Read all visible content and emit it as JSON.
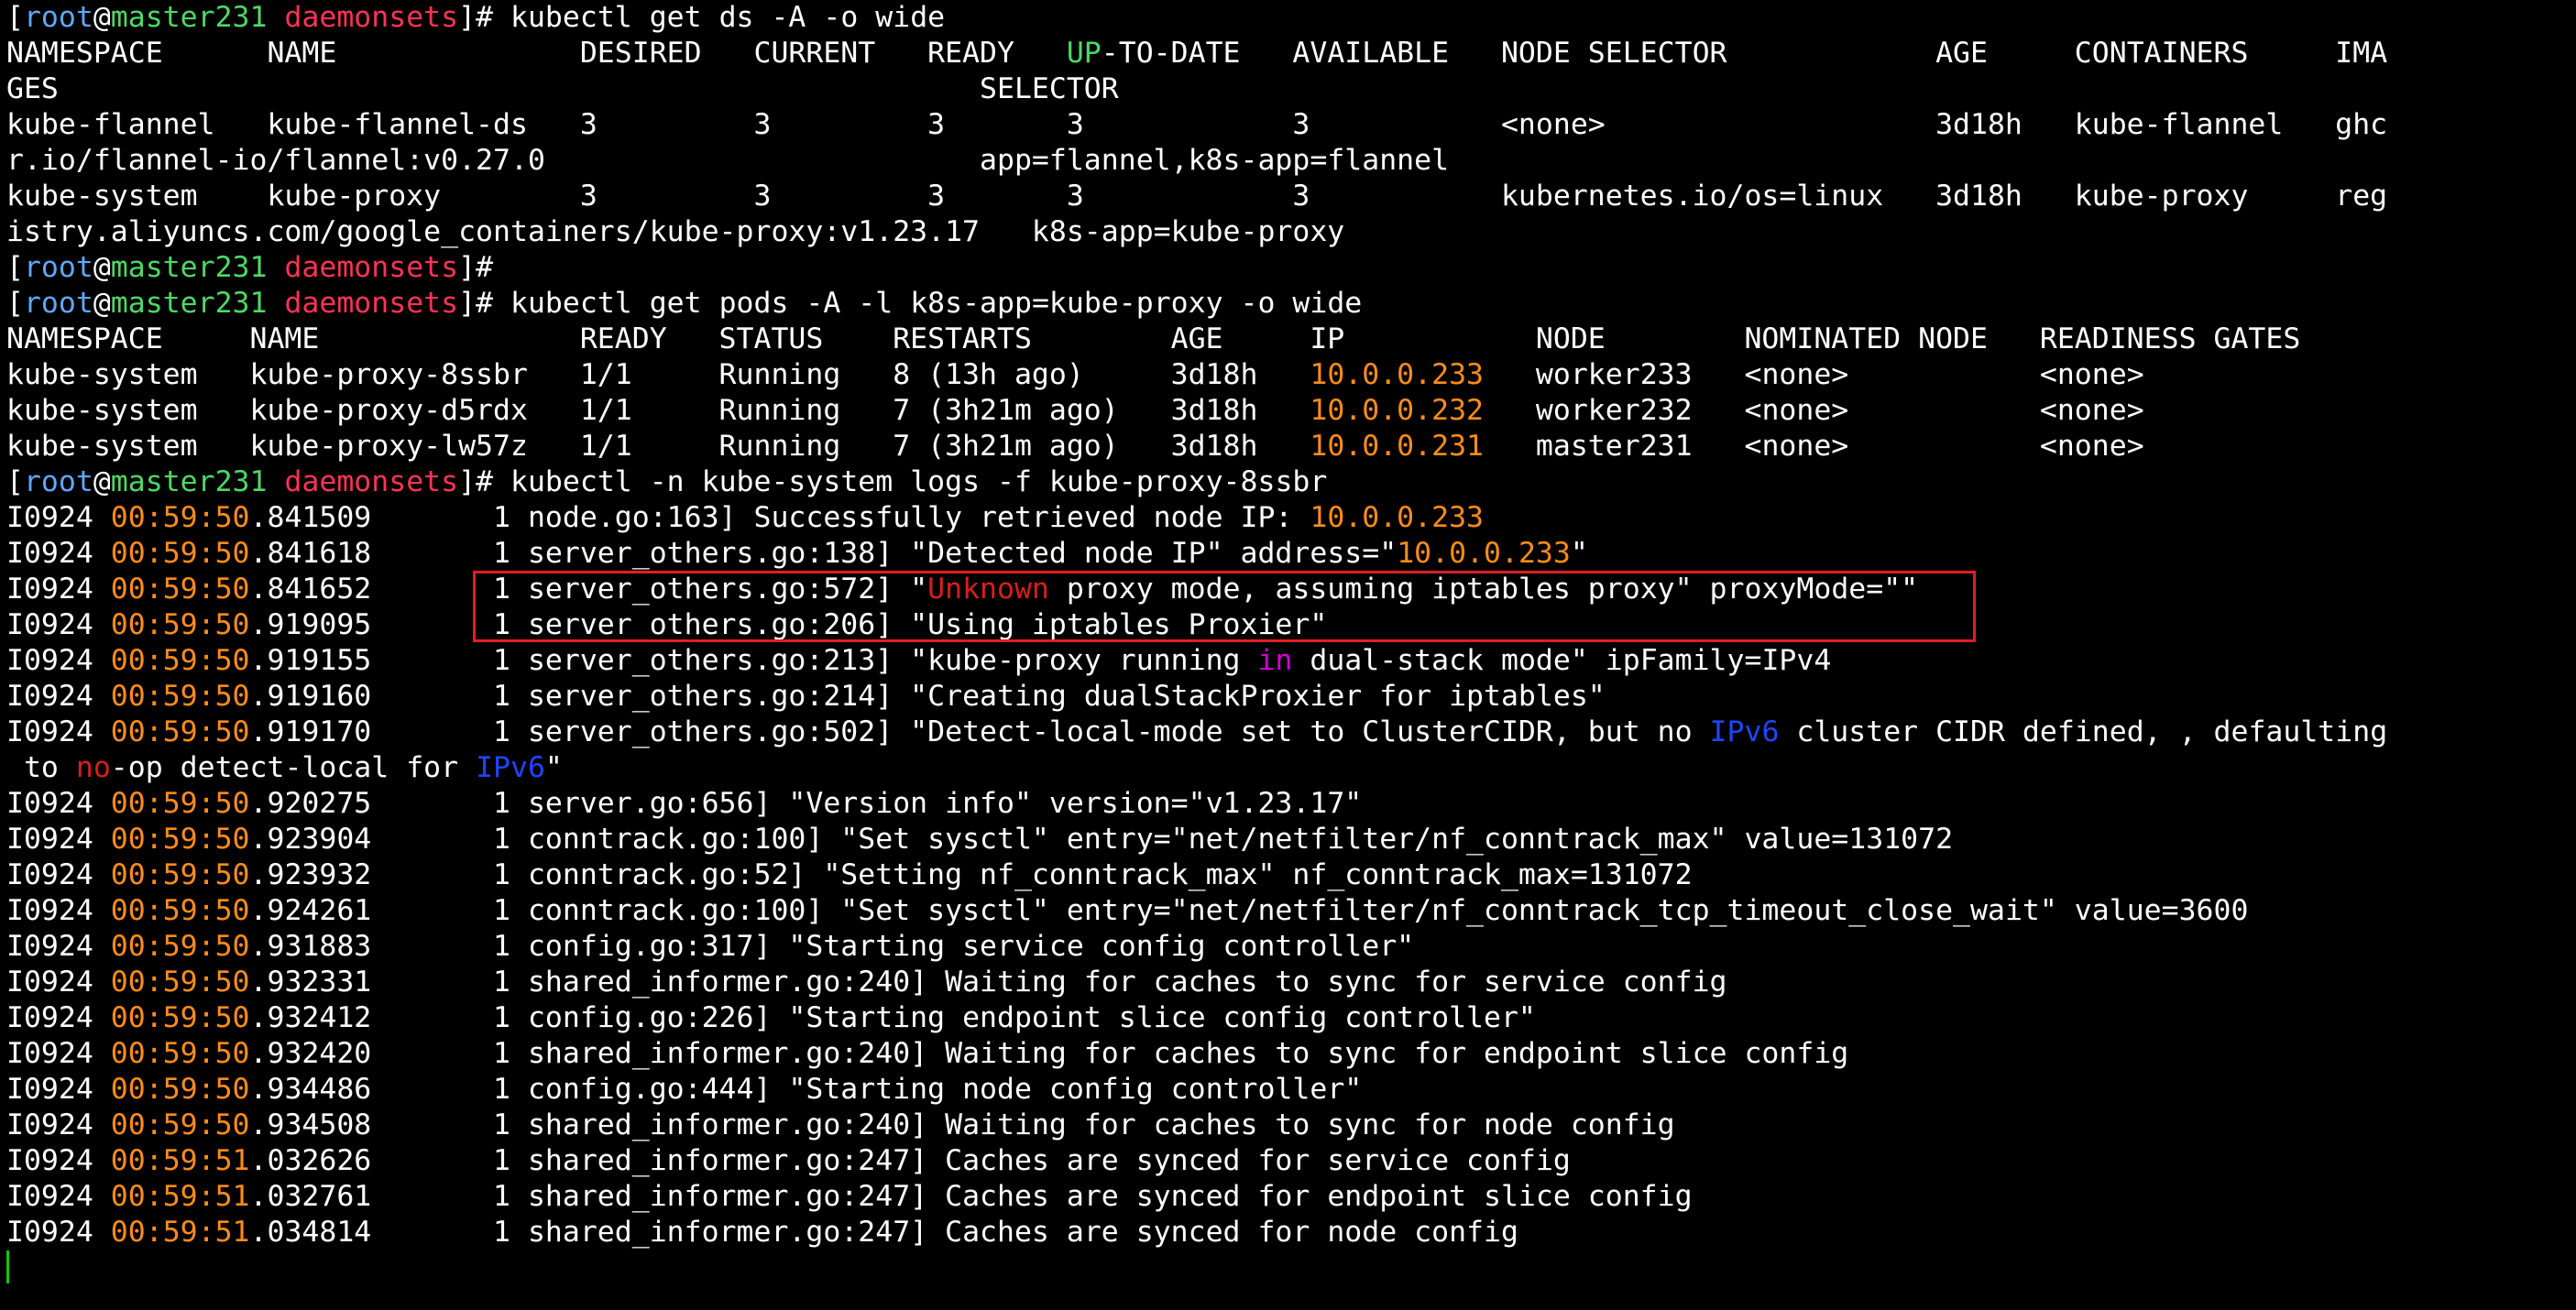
{
  "colors": {
    "background": "#000000",
    "text": "#ffffff",
    "prompt_user": "#5fa8ff",
    "prompt_host": "#4cd964",
    "prompt_dir": "#ff3355",
    "ip_highlight": "#ff8c1a",
    "keyword_red": "#d81e1e",
    "keyword_blue": "#1f45ff",
    "keyword_magenta": "#d000d0",
    "highlight_box": "#e31e24",
    "cursor": "#00d000"
  },
  "terminal": {
    "lines": [
      [
        {
          "t": "[",
          "c": "w"
        },
        {
          "t": "root",
          "c": "pu"
        },
        {
          "t": "@",
          "c": "w"
        },
        {
          "t": "master231",
          "c": "ph"
        },
        {
          "t": " ",
          "c": "w"
        },
        {
          "t": "daemonsets",
          "c": "pd"
        },
        {
          "t": "]# kubectl get ds -A -o wide",
          "c": "w"
        }
      ],
      [
        {
          "t": "NAMESPACE      NAME              DESIRED   CURRENT   READY   ",
          "c": "w"
        },
        {
          "t": "UP",
          "c": "ph"
        },
        {
          "t": "-TO-DATE   AVAILABLE   NODE SELECTOR            AGE     CONTAINERS     IMA",
          "c": "w"
        }
      ],
      [
        {
          "t": "GES                                                     SELECTOR",
          "c": "w"
        }
      ],
      [
        {
          "t": "kube-flannel   kube-flannel-ds   3         3         3       3            3           <none>                   3d18h   kube-flannel   ghc",
          "c": "w"
        }
      ],
      [
        {
          "t": "r.io/flannel-io/flannel:v0.27.0                         app=flannel,k8s-app=flannel",
          "c": "w"
        }
      ],
      [
        {
          "t": "kube-system    kube-proxy        3         3         3       3            3           kubernetes.io/os=linux   3d18h   kube-proxy     reg",
          "c": "w"
        }
      ],
      [
        {
          "t": "istry.aliyuncs.com/google_containers/kube-proxy:v1.23.17   k8s-app=kube-proxy",
          "c": "w"
        }
      ],
      [
        {
          "t": "[",
          "c": "w"
        },
        {
          "t": "root",
          "c": "pu"
        },
        {
          "t": "@",
          "c": "w"
        },
        {
          "t": "master231",
          "c": "ph"
        },
        {
          "t": " ",
          "c": "w"
        },
        {
          "t": "daemonsets",
          "c": "pd"
        },
        {
          "t": "]#",
          "c": "w"
        }
      ],
      [
        {
          "t": "[",
          "c": "w"
        },
        {
          "t": "root",
          "c": "pu"
        },
        {
          "t": "@",
          "c": "w"
        },
        {
          "t": "master231",
          "c": "ph"
        },
        {
          "t": " ",
          "c": "w"
        },
        {
          "t": "daemonsets",
          "c": "pd"
        },
        {
          "t": "]# kubectl get pods -A -l k8s-app=kube-proxy -o wide",
          "c": "w"
        }
      ],
      [
        {
          "t": "NAMESPACE     NAME               READY   STATUS    RESTARTS        AGE     IP           NODE        NOMINATED NODE   READINESS GATES",
          "c": "w"
        }
      ],
      [
        {
          "t": "kube-system   kube-proxy-8ssbr   1/1     Running   8 (13h ago)     3d18h   ",
          "c": "w"
        },
        {
          "t": "10.0.0.233",
          "c": "ip"
        },
        {
          "t": "   worker233   <none>           <none>",
          "c": "w"
        }
      ],
      [
        {
          "t": "kube-system   kube-proxy-d5rdx   1/1     Running   7 (3h21m ago)   3d18h   ",
          "c": "w"
        },
        {
          "t": "10.0.0.232",
          "c": "ip"
        },
        {
          "t": "   worker232   <none>           <none>",
          "c": "w"
        }
      ],
      [
        {
          "t": "kube-system   kube-proxy-lw57z   1/1     Running   7 (3h21m ago)   3d18h   ",
          "c": "w"
        },
        {
          "t": "10.0.0.231",
          "c": "ip"
        },
        {
          "t": "   master231   <none>           <none>",
          "c": "w"
        }
      ],
      [
        {
          "t": "[",
          "c": "w"
        },
        {
          "t": "root",
          "c": "pu"
        },
        {
          "t": "@",
          "c": "w"
        },
        {
          "t": "master231",
          "c": "ph"
        },
        {
          "t": " ",
          "c": "w"
        },
        {
          "t": "daemonsets",
          "c": "pd"
        },
        {
          "t": "]# kubectl -n kube-system logs -f kube-proxy-8ssbr",
          "c": "w"
        }
      ],
      [
        {
          "t": "I0924 ",
          "c": "w"
        },
        {
          "t": "00:59:50",
          "c": "ip"
        },
        {
          "t": ".841509       1 node.go:163] Successfully retrieved node IP: ",
          "c": "w"
        },
        {
          "t": "10.0.0.233",
          "c": "ip"
        }
      ],
      [
        {
          "t": "I0924 ",
          "c": "w"
        },
        {
          "t": "00:59:50",
          "c": "ip"
        },
        {
          "t": ".841618       1 server_others.go:138] \"Detected node IP\" address=\"",
          "c": "w"
        },
        {
          "t": "10.0.0.233",
          "c": "ip"
        },
        {
          "t": "\"",
          "c": "w"
        }
      ],
      [
        {
          "t": "I0924 ",
          "c": "w"
        },
        {
          "t": "00:59:50",
          "c": "ip"
        },
        {
          "t": ".841652       1 server_others.go:572] \"",
          "c": "w"
        },
        {
          "t": "Unknown",
          "c": "kr"
        },
        {
          "t": " proxy mode, assuming iptables proxy\" proxyMode=\"\"",
          "c": "w"
        }
      ],
      [
        {
          "t": "I0924 ",
          "c": "w"
        },
        {
          "t": "00:59:50",
          "c": "ip"
        },
        {
          "t": ".919095       1 server_others.go:206] \"Using iptables Proxier\"",
          "c": "w"
        }
      ],
      [
        {
          "t": "I0924 ",
          "c": "w"
        },
        {
          "t": "00:59:50",
          "c": "ip"
        },
        {
          "t": ".919155       1 server_others.go:213] \"kube-proxy running ",
          "c": "w"
        },
        {
          "t": "in",
          "c": "km"
        },
        {
          "t": " dual-stack mode\" ipFamily=IPv4",
          "c": "w"
        }
      ],
      [
        {
          "t": "I0924 ",
          "c": "w"
        },
        {
          "t": "00:59:50",
          "c": "ip"
        },
        {
          "t": ".919160       1 server_others.go:214] \"Creating dualStackProxier for iptables\"",
          "c": "w"
        }
      ],
      [
        {
          "t": "I0924 ",
          "c": "w"
        },
        {
          "t": "00:59:50",
          "c": "ip"
        },
        {
          "t": ".919170       1 server_others.go:502] \"Detect-local-mode set to ClusterCIDR, but no ",
          "c": "w"
        },
        {
          "t": "IPv6",
          "c": "kb"
        },
        {
          "t": " cluster CIDR defined, , defaulting",
          "c": "w"
        }
      ],
      [
        {
          "t": " to ",
          "c": "w"
        },
        {
          "t": "no",
          "c": "kr"
        },
        {
          "t": "-op detect-local for ",
          "c": "w"
        },
        {
          "t": "IPv6",
          "c": "kb"
        },
        {
          "t": "\"",
          "c": "w"
        }
      ],
      [
        {
          "t": "I0924 ",
          "c": "w"
        },
        {
          "t": "00:59:50",
          "c": "ip"
        },
        {
          "t": ".920275       1 server.go:656] \"Version info\" version=\"v1.23.17\"",
          "c": "w"
        }
      ],
      [
        {
          "t": "I0924 ",
          "c": "w"
        },
        {
          "t": "00:59:50",
          "c": "ip"
        },
        {
          "t": ".923904       1 conntrack.go:100] \"Set sysctl\" entry=\"net/netfilter/nf_conntrack_max\" value=131072",
          "c": "w"
        }
      ],
      [
        {
          "t": "I0924 ",
          "c": "w"
        },
        {
          "t": "00:59:50",
          "c": "ip"
        },
        {
          "t": ".923932       1 conntrack.go:52] \"Setting nf_conntrack_max\" nf_conntrack_max=131072",
          "c": "w"
        }
      ],
      [
        {
          "t": "I0924 ",
          "c": "w"
        },
        {
          "t": "00:59:50",
          "c": "ip"
        },
        {
          "t": ".924261       1 conntrack.go:100] \"Set sysctl\" entry=\"net/netfilter/nf_conntrack_tcp_timeout_close_wait\" value=3600",
          "c": "w"
        }
      ],
      [
        {
          "t": "I0924 ",
          "c": "w"
        },
        {
          "t": "00:59:50",
          "c": "ip"
        },
        {
          "t": ".931883       1 config.go:317] \"Starting service config controller\"",
          "c": "w"
        }
      ],
      [
        {
          "t": "I0924 ",
          "c": "w"
        },
        {
          "t": "00:59:50",
          "c": "ip"
        },
        {
          "t": ".932331       1 shared_informer.go:240] Waiting for caches to sync for service config",
          "c": "w"
        }
      ],
      [
        {
          "t": "I0924 ",
          "c": "w"
        },
        {
          "t": "00:59:50",
          "c": "ip"
        },
        {
          "t": ".932412       1 config.go:226] \"Starting endpoint slice config controller\"",
          "c": "w"
        }
      ],
      [
        {
          "t": "I0924 ",
          "c": "w"
        },
        {
          "t": "00:59:50",
          "c": "ip"
        },
        {
          "t": ".932420       1 shared_informer.go:240] Waiting for caches to sync for endpoint slice config",
          "c": "w"
        }
      ],
      [
        {
          "t": "I0924 ",
          "c": "w"
        },
        {
          "t": "00:59:50",
          "c": "ip"
        },
        {
          "t": ".934486       1 config.go:444] \"Starting node config controller\"",
          "c": "w"
        }
      ],
      [
        {
          "t": "I0924 ",
          "c": "w"
        },
        {
          "t": "00:59:50",
          "c": "ip"
        },
        {
          "t": ".934508       1 shared_informer.go:240] Waiting for caches to sync for node config",
          "c": "w"
        }
      ],
      [
        {
          "t": "I0924 ",
          "c": "w"
        },
        {
          "t": "00:59:51",
          "c": "ip"
        },
        {
          "t": ".032626       1 shared_informer.go:247] Caches are synced for service config",
          "c": "w"
        }
      ],
      [
        {
          "t": "I0924 ",
          "c": "w"
        },
        {
          "t": "00:59:51",
          "c": "ip"
        },
        {
          "t": ".032761       1 shared_informer.go:247] Caches are synced for endpoint slice config",
          "c": "w"
        }
      ],
      [
        {
          "t": "I0924 ",
          "c": "w"
        },
        {
          "t": "00:59:51",
          "c": "ip"
        },
        {
          "t": ".034814       1 shared_informer.go:247] Caches are synced for node config",
          "c": "w"
        }
      ]
    ]
  }
}
